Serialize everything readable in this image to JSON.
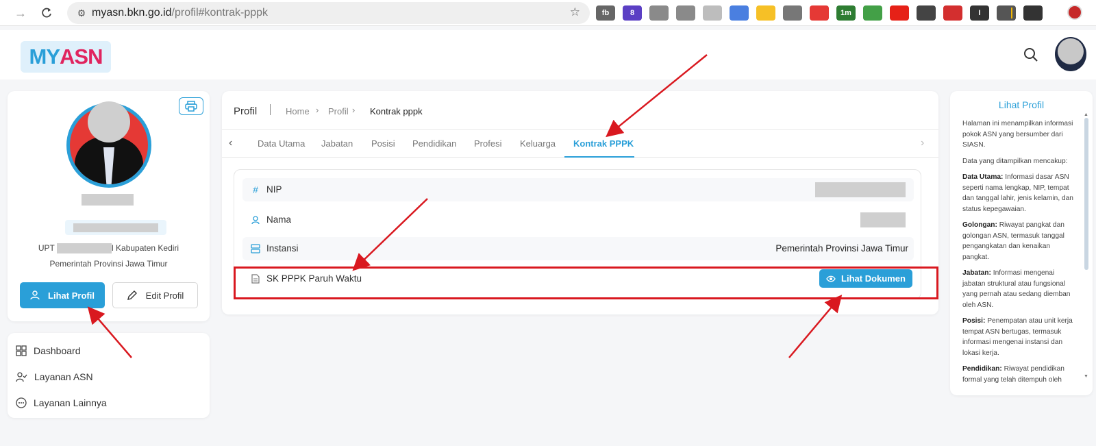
{
  "browser": {
    "url_host": "myasn.bkn.go.id",
    "url_path": "/profil#kontrak-pppk",
    "extensions": [
      {
        "icon": "fb-ext-icon",
        "text": "fb",
        "color": "#666666"
      },
      {
        "icon": "stack-ext-icon",
        "text": "8",
        "color": "#5b3fc4"
      },
      {
        "icon": "gallery-ext-icon",
        "text": "",
        "color": "#8a8a8a"
      },
      {
        "icon": "camera-ext-icon",
        "text": "",
        "color": "#8a8a8a"
      },
      {
        "icon": "note-ext-icon",
        "text": "",
        "color": "#bdbdbd"
      },
      {
        "icon": "translate-ext-icon",
        "text": "",
        "color": "#4a7fe0"
      },
      {
        "icon": "keep-ext-icon",
        "text": "",
        "color": "#f6c026"
      },
      {
        "icon": "link-ext-icon",
        "text": "",
        "color": "#777777"
      },
      {
        "icon": "pokeball-ext-icon",
        "text": "",
        "color": "#e53935"
      },
      {
        "icon": "timer-ext-icon",
        "text": "1m",
        "color": "#2e7d32"
      },
      {
        "icon": "globe-ext-icon",
        "text": "",
        "color": "#43a047"
      },
      {
        "icon": "youtube-ext-icon",
        "text": "",
        "color": "#e62117"
      },
      {
        "icon": "qr-ext-icon",
        "text": "",
        "color": "#444444"
      },
      {
        "icon": "red-circle-ext-icon",
        "text": "",
        "color": "#d32f2f"
      },
      {
        "icon": "cursor-ext-icon",
        "text": "I",
        "color": "#333333"
      },
      {
        "icon": "puzzle-ext-icon",
        "text": "",
        "color": "#555555"
      },
      {
        "icon": "playlist-ext-icon",
        "text": "",
        "color": "#333333"
      }
    ]
  },
  "header": {
    "logo_my": "MY",
    "logo_asn": "ASN"
  },
  "profile": {
    "upt_prefix": "UPT",
    "upt_suffix": "l Kabupaten Kediri",
    "org": "Pemerintah Provinsi Jawa Timur",
    "view_btn": "Lihat Profil",
    "edit_btn": "Edit Profil"
  },
  "nav": [
    {
      "label": "Dashboard",
      "icon": "grid-icon"
    },
    {
      "label": "Layanan ASN",
      "icon": "user-check-icon"
    },
    {
      "label": "Layanan Lainnya",
      "icon": "more-icon"
    }
  ],
  "breadcrumb": {
    "title": "Profil",
    "home": "Home",
    "profil": "Profil",
    "current": "Kontrak pppk"
  },
  "tabs": [
    "Data Utama",
    "Jabatan",
    "Posisi",
    "Pendidikan",
    "Profesi",
    "Keluarga",
    "Kontrak PPPK"
  ],
  "active_tab": "Kontrak PPPK",
  "details": {
    "nip_label": "NIP",
    "nama_label": "Nama",
    "instansi_label": "Instansi",
    "instansi_value": "Pemerintah Provinsi Jawa Timur",
    "sk_label": "SK PPPK Paruh Waktu",
    "doc_btn": "Lihat Dokumen"
  },
  "help": {
    "title": "Lihat Profil",
    "intro": "Halaman ini menampilkan informasi pokok ASN yang bersumber dari SIASN.",
    "list_intro": "Data yang ditampilkan mencakup:",
    "items": [
      {
        "term": "Data Utama:",
        "desc": "Informasi dasar ASN seperti nama lengkap, NIP, tempat dan tanggal lahir, jenis kelamin, dan status kepegawaian."
      },
      {
        "term": "Golongan:",
        "desc": "Riwayat pangkat dan golongan ASN, termasuk tanggal pengangkatan dan kenaikan pangkat."
      },
      {
        "term": "Jabatan:",
        "desc": "Informasi mengenai jabatan struktural atau fungsional yang pernah atau sedang diemban oleh ASN."
      },
      {
        "term": "Posisi:",
        "desc": "Penempatan atau unit kerja tempat ASN bertugas, termasuk informasi mengenai instansi dan lokasi kerja."
      },
      {
        "term": "Pendidikan:",
        "desc": "Riwayat pendidikan formal yang telah ditempuh oleh"
      }
    ]
  },
  "colors": {
    "accent": "#2a9fd8",
    "annotation": "#d9181f"
  }
}
